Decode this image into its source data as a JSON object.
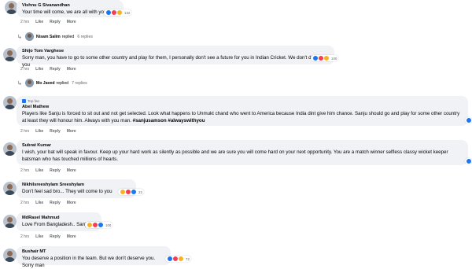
{
  "comments": [
    {
      "name": "Vishnu G Sivanandhan",
      "text": "Your time will come, we are all with you",
      "reaction_count": "132",
      "time": "2 hrs"
    },
    {
      "name": "Shijo Tom Varghese",
      "text": "Sorry man, you have to go to some other country and play for them, I personally don't see a future for you in Indian Cricket. We don't deserve you",
      "reaction_count": "100",
      "time": "2 hrs"
    },
    {
      "badge": "Top fan",
      "name": "Abel Mathew",
      "text": "Players like Sanju is forced to sit out and not get selected. Look what happens to Unmukt chand who went to America because India dint give him chance. Sanju should go and play for some other country at least they will honour him. Always with you man.",
      "hashtags": "#sanjusamson #alwayswithyou",
      "time": "2 hrs"
    },
    {
      "name": "Subrat Kumar",
      "text": "I wish, your bat will speak in favour. Keep up your hard work as silently as possible and we are sure you will come hard on your next opportunity. You are a match winner selfless classy wicket keeper batsman who has touched millions of hearts.",
      "time": "2 hrs"
    },
    {
      "name": "Nikhilsreeshylam Sreeshylam",
      "text": "Don't feel sad bro... They will come to you",
      "reaction_count": "22",
      "time": "2 hrs"
    },
    {
      "name": "MdRasel Mahmud",
      "text": "Love From Bangladesh.. Sanju.",
      "reaction_count": "100",
      "time": "2 hrs"
    },
    {
      "name": "Bushair MT",
      "text": "You deserve a position in the team. But we don't deserve you. Sorry man",
      "reaction_count": "72",
      "time": "2 hrs"
    }
  ],
  "replies": [
    {
      "name": "Nisam Salim",
      "verb": "replied",
      "count": "6 replies"
    },
    {
      "name": "Mo Javed",
      "verb": "replied",
      "count": "7 replies"
    }
  ],
  "actions": {
    "like": "Like",
    "reply": "Reply",
    "more": "More"
  },
  "colors": {
    "bubble": "#f0f2f5",
    "like_blue": "#1877f2",
    "love_red": "#f33e58",
    "care_yellow": "#f7b125"
  }
}
